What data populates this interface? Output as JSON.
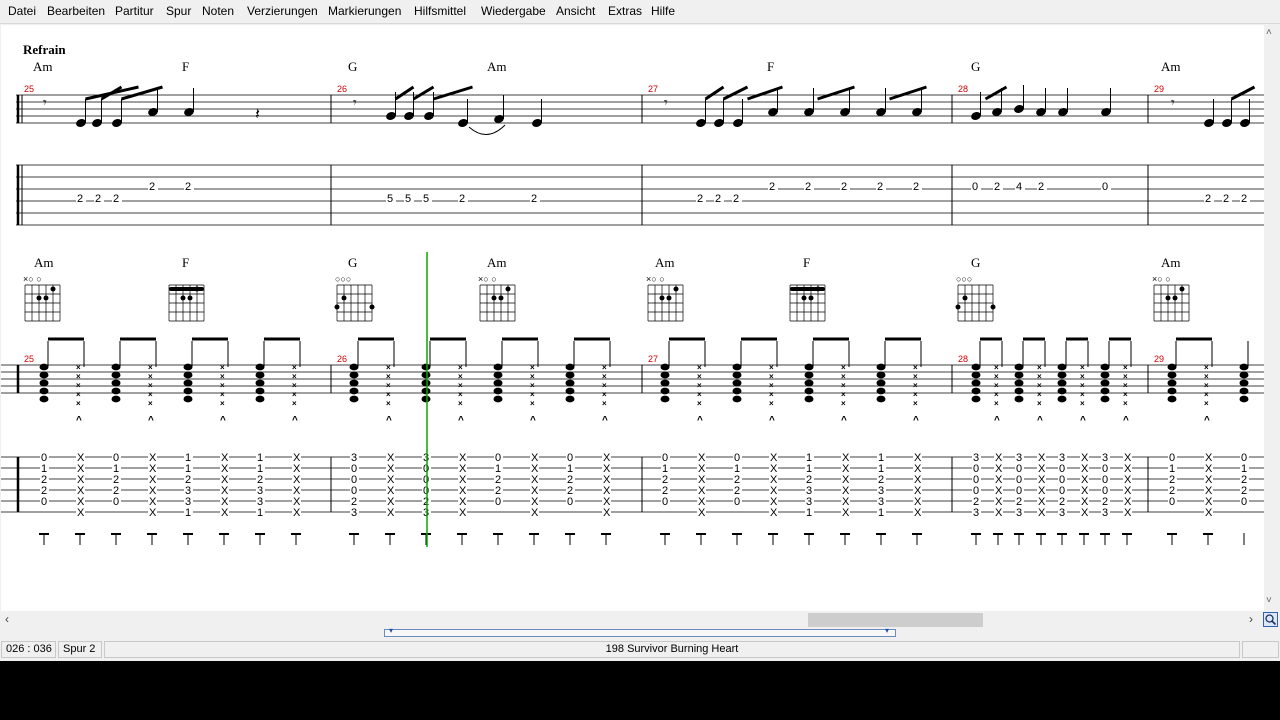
{
  "menu": {
    "items": [
      "Datei",
      "Bearbeiten",
      "Partitur",
      "Spur",
      "Noten",
      "Verzierungen",
      "Markierungen",
      "Hilfsmittel",
      "Wiedergabe",
      "Ansicht",
      "Extras",
      "Hilfe"
    ]
  },
  "score": {
    "section_title": "Refrain",
    "row1": {
      "chords": [
        "Am",
        "F",
        "G",
        "Am",
        "F",
        "G",
        "Am"
      ],
      "bar_numbers": [
        "25",
        "26",
        "27",
        "28",
        "29"
      ],
      "tab_numbers": [
        "2",
        "2",
        "2",
        "2",
        "2",
        "5",
        "5",
        "5",
        "2",
        "2",
        "2",
        "2",
        "2",
        "2",
        "2",
        "2",
        "2",
        "2",
        "0",
        "2",
        "4",
        "2",
        "0",
        "2",
        "2",
        "2"
      ]
    },
    "row2": {
      "chords": [
        "Am",
        "F",
        "G",
        "Am",
        "Am",
        "F",
        "G",
        "Am"
      ],
      "bar_numbers": [
        "25",
        "26",
        "27",
        "28",
        "29"
      ],
      "fingerings": {
        "Am": [
          "0",
          "1",
          "2",
          "2",
          "0"
        ],
        "F": [
          "1",
          "1",
          "2",
          "3",
          "3",
          "1"
        ],
        "G": [
          "3",
          "0",
          "0",
          "0",
          "2",
          "3"
        ],
        "X": "X"
      }
    }
  },
  "scroll": {
    "left_arrow": "‹",
    "right_arrow": "›",
    "up_arrow": "˄",
    "down_arrow": "˅"
  },
  "splitter": {
    "left_marker": "▾",
    "right_marker": "▾"
  },
  "status": {
    "position": "026 : 036",
    "track": "Spur 2",
    "song": "198  Survivor   Burning Heart"
  },
  "colors": {
    "cursor": "#00aa00",
    "bar_number": "#d00000"
  }
}
